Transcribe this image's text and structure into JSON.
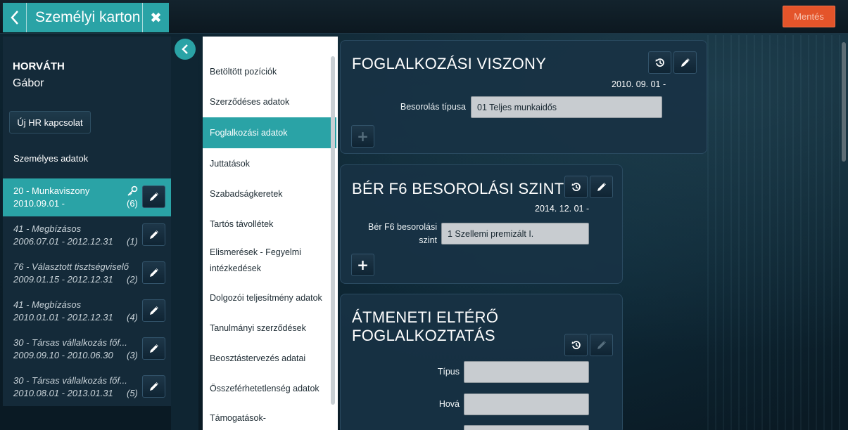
{
  "header": {
    "title": "Személyi karton",
    "save_label": "Mentés"
  },
  "person": {
    "last_name": "HORVÁTH",
    "first_name": "Gábor"
  },
  "sidebar": {
    "new_hr_label": "Új HR kapcsolat",
    "personal_data_label": "Személyes adatok",
    "relations": [
      {
        "title": "20 - Munkaviszony",
        "dates": "2010.09.01 -",
        "count": "(6)"
      },
      {
        "title": "41 - Megbízásos",
        "dates": "2006.07.01 - 2012.12.31",
        "count": "(1)"
      },
      {
        "title": "76 - Választott tisztségviselő",
        "dates": "2009.01.15 - 2012.12.31",
        "count": "(2)"
      },
      {
        "title": "41 - Megbízásos",
        "dates": "2010.01.01 - 2012.12.31",
        "count": "(4)"
      },
      {
        "title": "30 - Társas vállalkozás főf...",
        "dates": "2009.09.10 - 2010.06.30",
        "count": "(3)"
      },
      {
        "title": "30 - Társas vállalkozás főf...",
        "dates": "2010.08.01 - 2013.01.31",
        "count": "(5)"
      }
    ]
  },
  "nav": {
    "items": [
      "Betöltött pozíciók",
      "Szerződéses adatok",
      "Foglalkozási adatok",
      "Juttatások",
      "Szabadságkeretek",
      "Tartós távollétek",
      "Elismerések - Fegyelmi",
      "intézkedések",
      "Dolgozói teljesítmény adatok",
      "Tanulmányi szerződések",
      "Beosztástervezés adatai",
      "Összeférhetetlenség adatok",
      "Támogatások-"
    ]
  },
  "cards": {
    "employment": {
      "title": "FOGLALKOZÁSI VISZONY",
      "date": "2010. 09. 01 -",
      "field_label": "Besorolás típusa",
      "field_value": "01 Teljes munkaidős",
      "plus": "+"
    },
    "salary": {
      "title": "BÉR F6 BESOROLÁSI SZINT",
      "date": "2014. 12. 01 -",
      "field_label_1": "Bér F6 besorolási",
      "field_label_2": "szint",
      "field_value": "1 Szellemi premizált I.",
      "plus": "+"
    },
    "temporary": {
      "title": "ÁTMENETI ELTÉRŐ FOGLALKOZTATÁS",
      "type_label": "Típus",
      "type_value": "",
      "where_label": "Hová",
      "where_value": "",
      "third_value": ""
    }
  },
  "colors": {
    "accent": "#2aa3a6",
    "save": "#e4542a"
  }
}
